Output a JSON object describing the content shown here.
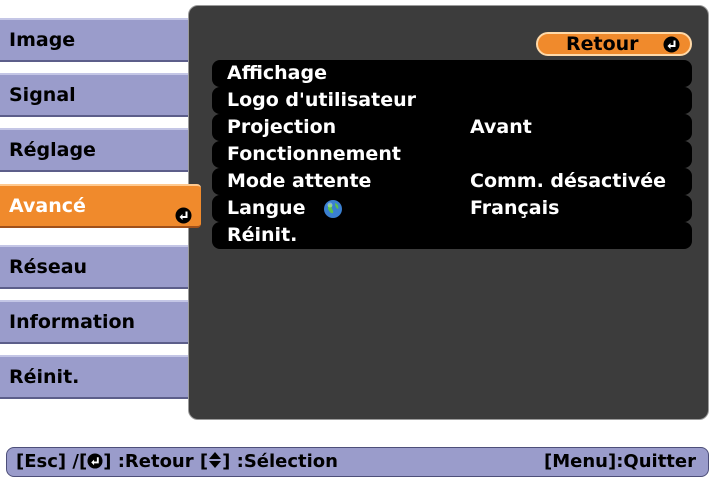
{
  "sidebar": {
    "items": [
      {
        "label": "Image"
      },
      {
        "label": "Signal"
      },
      {
        "label": "Réglage"
      },
      {
        "label": "Avancé",
        "active": true
      },
      {
        "label": "Réseau"
      },
      {
        "label": "Information"
      },
      {
        "label": "Réinit."
      }
    ],
    "active_icon": "enter-icon"
  },
  "panel": {
    "return_label": "Retour",
    "return_icon": "enter-icon",
    "options": [
      {
        "label": "Affichage",
        "value": ""
      },
      {
        "label": "Logo d'utilisateur",
        "value": ""
      },
      {
        "label": "Projection",
        "value": "Avant"
      },
      {
        "label": "Fonctionnement",
        "value": ""
      },
      {
        "label": "Mode attente",
        "value": "Comm. désactivée"
      },
      {
        "label": "Langue",
        "value": "Français",
        "icon": "globe-icon"
      },
      {
        "label": "Réinit.",
        "value": ""
      }
    ]
  },
  "help_bar": {
    "esc": "[Esc] /[",
    "back": "] :Retour  [",
    "select": "] :Sélection",
    "menu": "[Menu]:Quitter"
  },
  "colors": {
    "menu_item": "#9a9ccb",
    "active_orange": "#f08a2c",
    "panel_bg": "#3c3c3c",
    "option_bg": "#000000"
  }
}
